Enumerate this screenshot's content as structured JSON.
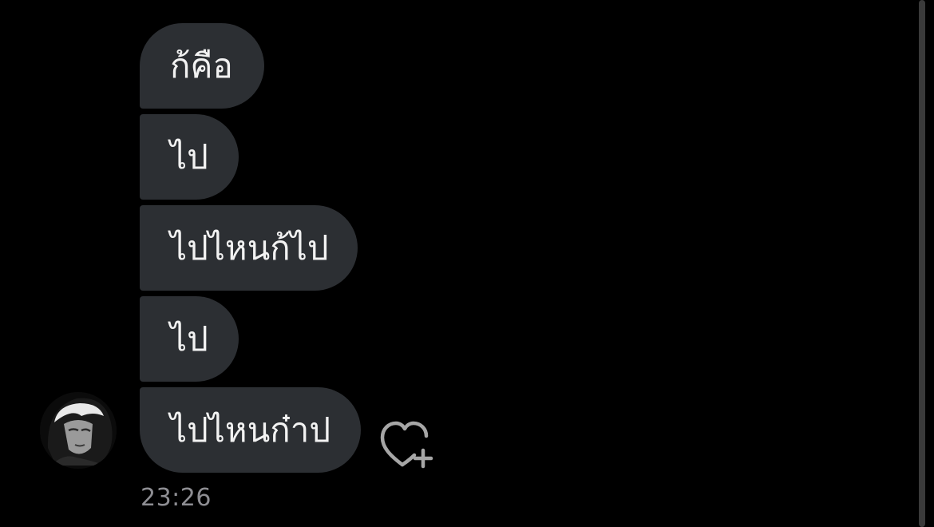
{
  "messages": [
    {
      "text": "ก้คือ"
    },
    {
      "text": "ไป"
    },
    {
      "text": "ไปไหนก้ไป"
    },
    {
      "text": "ไป"
    },
    {
      "text": "ไปไหนก๋าป"
    }
  ],
  "timestamp": "23:26",
  "icons": {
    "avatar": "profile-avatar",
    "reaction": "heart-plus-icon"
  },
  "colors": {
    "background": "#000000",
    "bubble": "#2c2f33",
    "bubble_text": "#f2f2f2",
    "timestamp": "#8e8e93"
  }
}
